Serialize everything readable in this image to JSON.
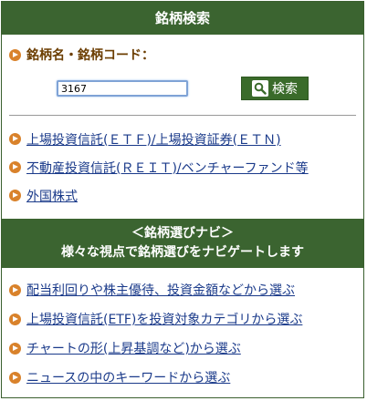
{
  "search_box": {
    "title": "銘柄検索",
    "label": "銘柄名・銘柄コード：",
    "input_value": "3167",
    "button_label": "検索"
  },
  "links": [
    {
      "label": "上場投資信託(ＥＴＦ)/上場投資証券(ＥＴＮ)"
    },
    {
      "label": "不動産投資信託(ＲＥＩＴ)/ベンチャーファンド等"
    },
    {
      "label": "外国株式"
    }
  ],
  "navi": {
    "title": "＜銘柄選びナビ＞",
    "subtitle": "様々な視点で銘柄選びをナビゲートします",
    "links": [
      {
        "label": "配当利回りや株主優待、投資金額などから選ぶ"
      },
      {
        "label": "上場投資信託(ETF)を投資対象カテゴリから選ぶ"
      },
      {
        "label": "チャートの形(上昇基調など)から選ぶ"
      },
      {
        "label": "ニュースの中のキーワードから選ぶ"
      }
    ]
  },
  "colors": {
    "header_bg": "#3b6430",
    "arrow": "#d9822b",
    "link": "#1a3a8a"
  },
  "icons": {
    "bullet": "arrow-circle-icon",
    "button": "magnifier-icon"
  }
}
